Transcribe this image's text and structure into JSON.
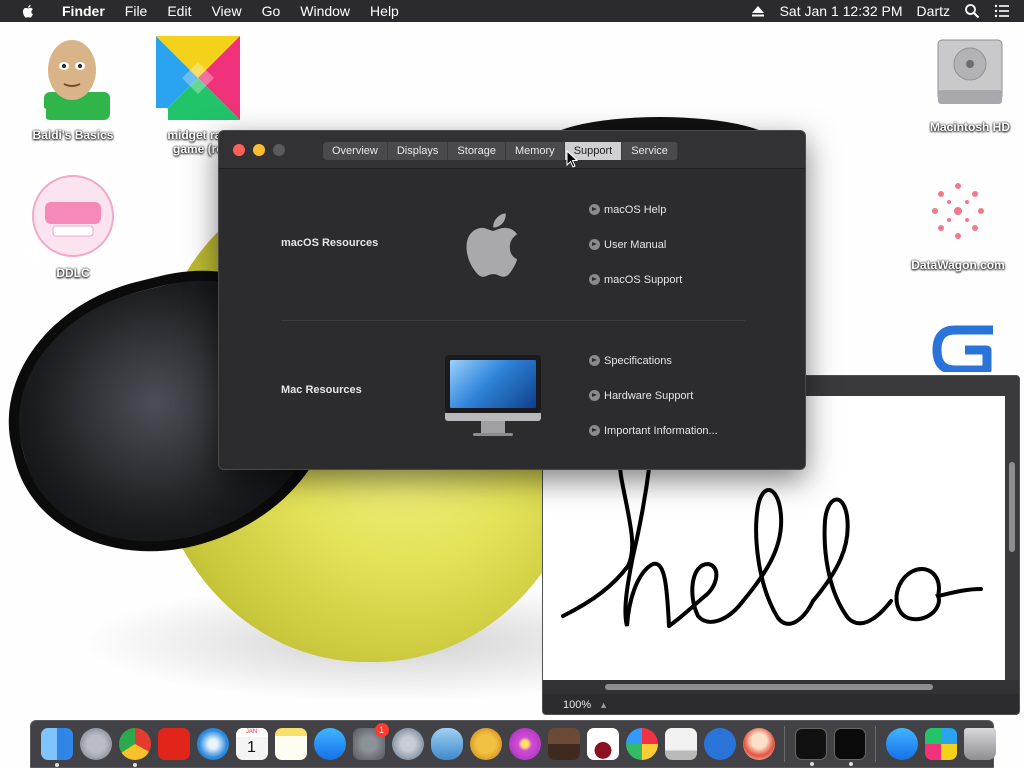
{
  "menubar": {
    "app": "Finder",
    "menus": [
      "File",
      "Edit",
      "View",
      "Go",
      "Window",
      "Help"
    ],
    "datetime": "Sat Jan 1  12:32 PM",
    "user": "Dartz"
  },
  "desktop": {
    "icons": [
      {
        "label": "Baldi's Basics"
      },
      {
        "label": "midget ran\ngame (re"
      },
      {
        "label": "DDLC"
      },
      {
        "label": "Macintosh HD"
      },
      {
        "label": "DataWagon.com"
      }
    ]
  },
  "about_window": {
    "tabs": [
      "Overview",
      "Displays",
      "Storage",
      "Memory",
      "Support",
      "Service"
    ],
    "active_tab": "Support",
    "sections": [
      {
        "title": "macOS Resources",
        "links": [
          "macOS Help",
          "User Manual",
          "macOS Support"
        ]
      },
      {
        "title": "Mac Resources",
        "links": [
          "Specifications",
          "Hardware Support",
          "Important Information..."
        ]
      }
    ]
  },
  "drawing_window": {
    "zoom": "100%",
    "drawing_text": "hello"
  },
  "dock": {
    "calendar_month": "JAN",
    "calendar_day": "1",
    "badge_count": "1",
    "items": [
      "finder",
      "launchpad",
      "chrome",
      "flipboard",
      "safari",
      "calendar",
      "notes",
      "app-store",
      "system-preferences",
      "screenshot",
      "sequel",
      "cheetah",
      "flower",
      "minecraft",
      "wine",
      "paintbrush",
      "mac-app",
      "gdevelop",
      "character",
      "terminal",
      "activity-monitor",
      "app-store-2",
      "mixed",
      "trash"
    ]
  },
  "colors": {
    "menubar_bg": "#2b2b2d",
    "window_bg": "#2c2c2e",
    "close": "#ff5f57",
    "minimize": "#febc2e",
    "active_tab": "#d0d0d2"
  }
}
